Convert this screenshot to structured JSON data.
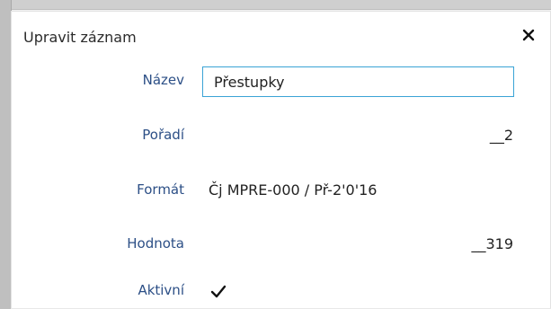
{
  "dialog": {
    "title": "Upravit záznam",
    "close_label": "×"
  },
  "fields": {
    "name": {
      "label": "Název",
      "value": "Přestupky"
    },
    "order": {
      "label": "Pořadí",
      "value": "__2"
    },
    "format": {
      "label": "Formát",
      "value": "Čj MPRE-000 / Př-2'0'16"
    },
    "value": {
      "label": "Hodnota",
      "value": "__319"
    },
    "active": {
      "label": "Aktivní",
      "checked": true
    }
  },
  "colors": {
    "label_text": "#2c4f86",
    "input_border": "#3aa3d6"
  },
  "icons": {
    "close": "close-icon",
    "check": "check-icon"
  }
}
